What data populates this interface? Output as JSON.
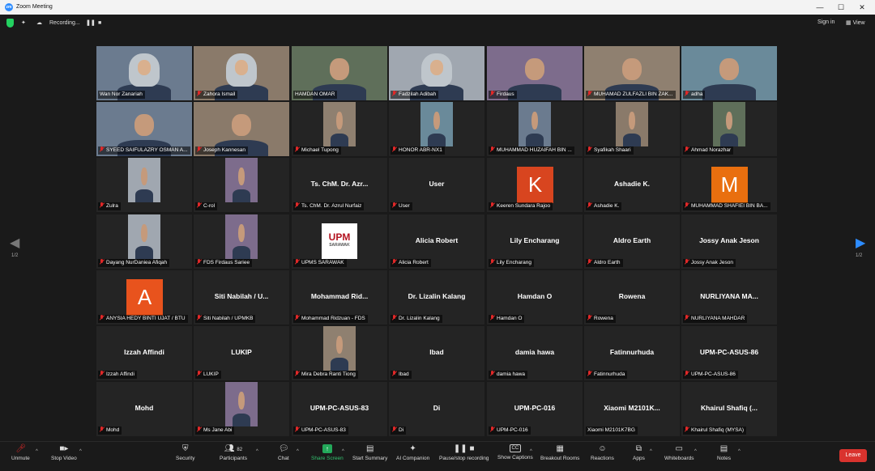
{
  "window": {
    "title": "Zoom Meeting",
    "controls": [
      "—",
      "☐",
      "✕"
    ]
  },
  "topbar": {
    "recording_label": "Recording...",
    "sign_in": "Sign in",
    "view_label": "View"
  },
  "page_indicator": {
    "left": "1/2",
    "right": "1/2"
  },
  "tiles": [
    {
      "name": "Wan Nor Zanariah",
      "kind": "video",
      "active": true
    },
    {
      "name": "Zahora Ismail",
      "kind": "video",
      "muted": true
    },
    {
      "name": "HAMDAN OMAR",
      "kind": "video",
      "muted": false
    },
    {
      "name": "Fadzilah Adibah",
      "kind": "video",
      "muted": true
    },
    {
      "name": "Firdaus",
      "kind": "video",
      "muted": true
    },
    {
      "name": "MUHAMAD ZULFAZLI BIN ZAK...",
      "kind": "video",
      "muted": true
    },
    {
      "name": "adha",
      "kind": "video",
      "muted": true
    },
    {
      "name": "SYEED SAIFULAZRY OSMAN A...",
      "kind": "video",
      "muted": true
    },
    {
      "name": "Joseph Kannesan",
      "kind": "video",
      "muted": true
    },
    {
      "name": "Michael Tupong",
      "kind": "photo",
      "muted": true
    },
    {
      "name": "HONOR ABR-NX1",
      "kind": "photo",
      "muted": true
    },
    {
      "name": "MUHAMMAD HUZAIFAH BIN ...",
      "kind": "photo",
      "muted": true
    },
    {
      "name": "Syafikah Shaari",
      "kind": "photo",
      "muted": true
    },
    {
      "name": "Ahmad Norazhar",
      "kind": "photo",
      "muted": true
    },
    {
      "name": "Zulra",
      "kind": "photo",
      "muted": true
    },
    {
      "name": "C-rol",
      "kind": "photo",
      "muted": true
    },
    {
      "name": "Ts. ChM. Dr. Azrul Nurfaiz",
      "big": "Ts. ChM. Dr. Azr...",
      "kind": "text",
      "muted": true
    },
    {
      "name": "User",
      "big": "User",
      "kind": "text",
      "muted": true
    },
    {
      "name": "Keeren Sundara Rajoo",
      "letter": "K",
      "color": "#d8451f",
      "kind": "letter",
      "muted": true
    },
    {
      "name": "Ashadie K.",
      "big": "Ashadie K.",
      "kind": "text",
      "muted": true
    },
    {
      "name": "MUHAMMAD SHAFIEI BIN BA...",
      "letter": "M",
      "color": "#e96f0f",
      "kind": "letter",
      "muted": true
    },
    {
      "name": "Dayang NurDaniea Afiqah",
      "kind": "photo",
      "muted": true
    },
    {
      "name": "FDS Firdaus Sariee",
      "kind": "photo",
      "muted": true
    },
    {
      "name": "UPMS SARAWAK",
      "kind": "logo",
      "logo_text": "UPM",
      "logo_sub": "SARAWAK",
      "muted": true
    },
    {
      "name": "Alicia Robert",
      "big": "Alicia Robert",
      "kind": "text",
      "muted": true
    },
    {
      "name": "Lily Encharang",
      "big": "Lily Encharang",
      "kind": "text",
      "muted": true
    },
    {
      "name": "Aldro Earth",
      "big": "Aldro Earth",
      "kind": "text",
      "muted": true
    },
    {
      "name": "Jossy Anak Jeson",
      "big": "Jossy Anak Jeson",
      "kind": "text",
      "muted": true
    },
    {
      "name": "ANYSIA HEDY BINTI UJAT / BTU",
      "letter": "A",
      "color": "#e8531d",
      "kind": "letter",
      "muted": true
    },
    {
      "name": "Siti Nabilah / UPMKB",
      "big": "Siti Nabilah / U...",
      "kind": "text",
      "muted": true
    },
    {
      "name": "Mohammad Ridzuan - FDS",
      "big": "Mohammad  Rid...",
      "kind": "text",
      "muted": true
    },
    {
      "name": "Dr. Lizalin Kalang",
      "big": "Dr. Lizalin Kalang",
      "kind": "text",
      "muted": true
    },
    {
      "name": "Hamdan O",
      "big": "Hamdan O",
      "kind": "text",
      "muted": true
    },
    {
      "name": "Rowena",
      "big": "Rowena",
      "kind": "text",
      "muted": true
    },
    {
      "name": "NURLIYANA MAHDAR",
      "big": "NURLIYANA MA...",
      "kind": "text",
      "muted": true
    },
    {
      "name": "Izzah Affindi",
      "big": "Izzah Affindi",
      "kind": "text",
      "muted": true
    },
    {
      "name": "LUKIP",
      "big": "LUKIP",
      "kind": "text",
      "muted": true
    },
    {
      "name": "Mira Debra Ranti Tiong",
      "kind": "photo",
      "muted": true
    },
    {
      "name": "Ibad",
      "big": "Ibad",
      "kind": "text",
      "muted": true
    },
    {
      "name": "damia hawa",
      "big": "damia hawa",
      "kind": "text",
      "muted": true
    },
    {
      "name": "Fatinnurhuda",
      "big": "Fatinnurhuda",
      "kind": "text",
      "muted": true
    },
    {
      "name": "UPM-PC-ASUS-86",
      "big": "UPM-PC-ASUS-86",
      "kind": "text",
      "muted": true
    },
    {
      "name": "Mohd",
      "big": "Mohd",
      "kind": "text",
      "muted": true
    },
    {
      "name": "Ms Jane Abi",
      "kind": "photo",
      "muted": true
    },
    {
      "name": "UPM-PC-ASUS-83",
      "big": "UPM-PC-ASUS-83",
      "kind": "text",
      "muted": true
    },
    {
      "name": "Di",
      "big": "Di",
      "kind": "text",
      "muted": true
    },
    {
      "name": "UPM-PC-016",
      "big": "UPM-PC-016",
      "kind": "text",
      "muted": true
    },
    {
      "name": "Xiaomi M2101K7BG",
      "big": "Xiaomi M2101K...",
      "kind": "text",
      "muted": false
    },
    {
      "name": "Khairul Shafiq (MYSA)",
      "big": "Khairul Shafiq (...",
      "kind": "text",
      "muted": true
    }
  ],
  "toolbar": {
    "unmute": "Unmute",
    "stop_video": "Stop Video",
    "security": "Security",
    "participants": "Participants",
    "participants_count": "82",
    "chat": "Chat",
    "share_screen": "Share Screen",
    "start_summary": "Start Summary",
    "ai_companion": "AI Companion",
    "pause_recording": "Pause/stop recording",
    "show_captions": "Show Captions",
    "breakout_rooms": "Breakout Rooms",
    "reactions": "Reactions",
    "apps": "Apps",
    "whiteboards": "Whiteboards",
    "notes": "Notes",
    "leave": "Leave"
  },
  "colors": {
    "accent_green": "#23a85a",
    "leave_red": "#d9332e",
    "active_border": "#c9e265"
  }
}
